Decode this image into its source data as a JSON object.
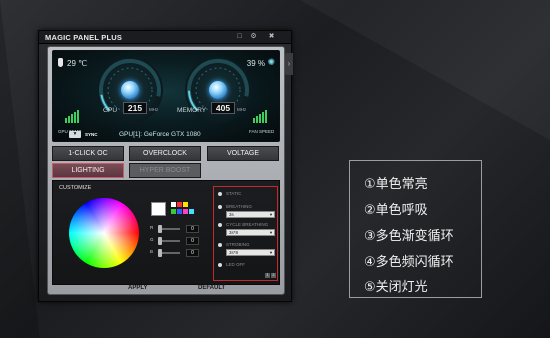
{
  "app": {
    "title": "MAGIC PANEL PLUS",
    "controls": {
      "minimize": "□",
      "settings": "⚙",
      "close": "✖"
    },
    "side_tab": "›"
  },
  "monitor": {
    "temperature": "29 ℃",
    "fan_percent": "39 %",
    "gpu_gauge": {
      "label": "GPU",
      "value": "215",
      "unit": "MHz"
    },
    "memory_gauge": {
      "label": "MEMORY",
      "value": "405",
      "unit": "MHz"
    },
    "gpu_temp_label": "GPU TEMP",
    "fan_speed_label": "FAN SPEED",
    "sync_label": "SYNC",
    "gpu_name": "GPU[1]: GeForce GTX 1080"
  },
  "tabs_row1": [
    "1-CLICK OC",
    "OVERCLOCK",
    "VOLTAGE"
  ],
  "tabs_row2": [
    "LIGHTING",
    "HYPER BOOST"
  ],
  "lighting": {
    "customize_label": "CUSTOMIZE",
    "sliders": [
      {
        "letter": "R",
        "value": "0"
      },
      {
        "letter": "G",
        "value": "0"
      },
      {
        "letter": "B",
        "value": "0"
      }
    ],
    "swatch_colors": [
      "#ffffff",
      "#ffffff",
      "#ff3030",
      "#ffe000",
      "#30d030",
      "#3060ff",
      "#ff40c0",
      "#40e0ff"
    ],
    "modes": [
      {
        "label": "STATIC"
      },
      {
        "label": "BREATHING",
        "select": "3s"
      },
      {
        "label": "CYCLE BREATHING",
        "select": "3s*8"
      },
      {
        "label": "STROBING",
        "select": "3s*8"
      },
      {
        "label": "LED OFF"
      }
    ],
    "pager": [
      "1",
      "2"
    ]
  },
  "footer": {
    "apply": "APPLY",
    "default": "DEFAULT"
  },
  "legend": [
    "①单色常亮",
    "②单色呼吸",
    "③多色渐变循环",
    "④多色频闪循环",
    "⑤关闭灯光"
  ]
}
